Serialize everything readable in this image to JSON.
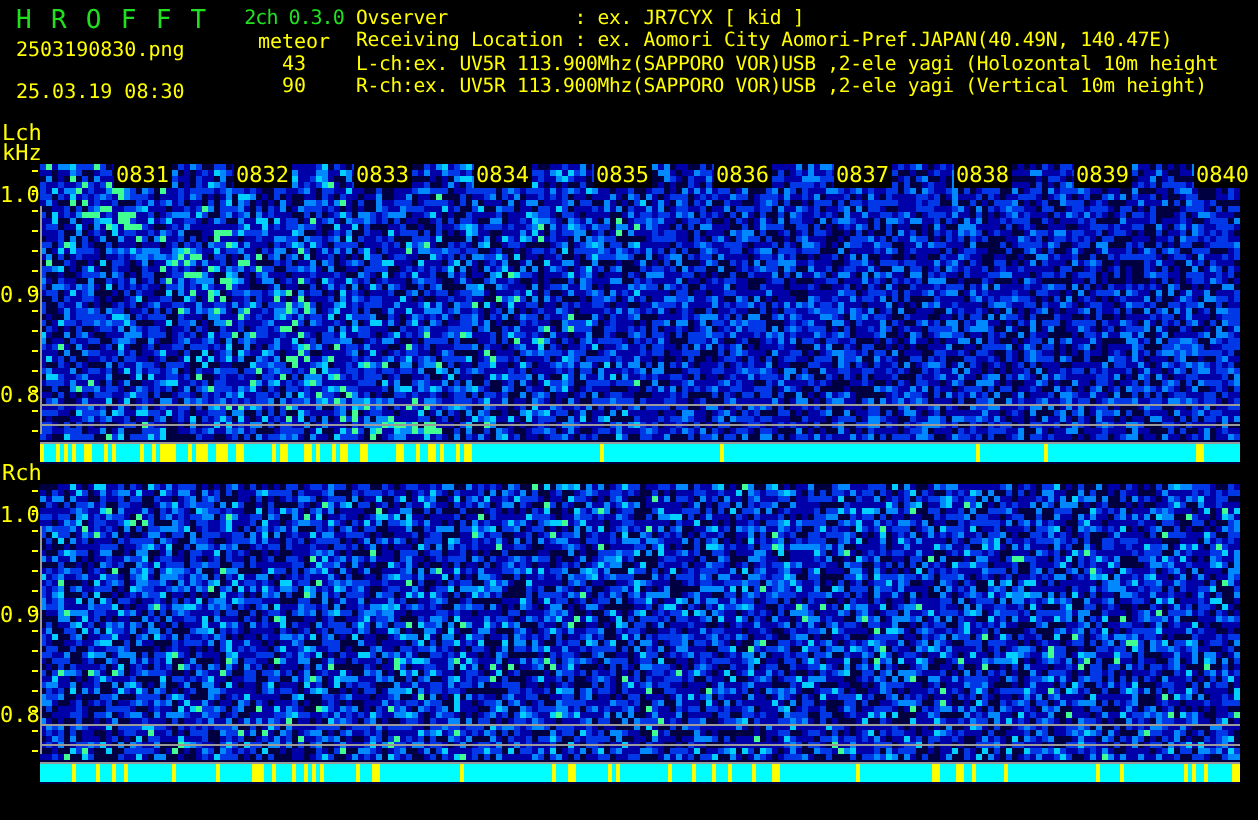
{
  "header": {
    "app_name": "H R O F F T",
    "version": "2ch 0.3.0",
    "filename": "2503190830.png",
    "datetime": "25.03.19 08:30",
    "mode": "meteor",
    "counts": [
      "43",
      "90"
    ],
    "info_lines": [
      "Ovserver           : ex. JR7CYX [ kid ]",
      "Receiving Location : ex. Aomori City Aomori-Pref.JAPAN(40.49N, 140.47E)",
      "L-ch:ex. UV5R 113.900Mhz(SAPPORO VOR)USB ,2-ele yagi (Holozontal 10m height",
      "R-ch:ex. UV5R 113.900Mhz(SAPPORO VOR)USB ,2-ele yagi (Vertical 10m height)"
    ]
  },
  "time_axis": [
    "0831",
    "0832",
    "0833",
    "0834",
    "0835",
    "0836",
    "0837",
    "0838",
    "0839",
    "0840"
  ],
  "channels": [
    {
      "label": "Lch",
      "unit": "kHz",
      "yticks": [
        "1.0",
        "0.9",
        "0.8"
      ]
    },
    {
      "label": "Rch",
      "yticks": [
        "1.0",
        "0.9",
        "0.8"
      ]
    }
  ]
}
